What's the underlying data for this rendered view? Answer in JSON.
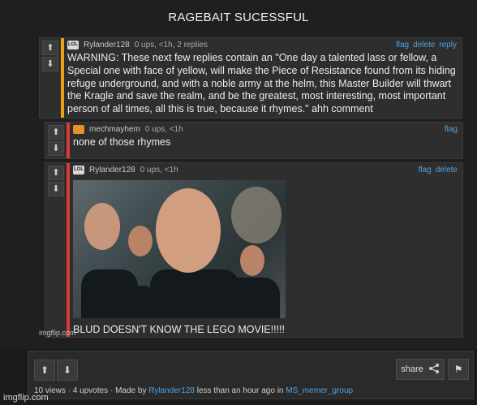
{
  "title": "RAGEBAIT SUCESSFUL",
  "comments": [
    {
      "username": "Rylander128",
      "meta": "0 ups, <1h, 2 replies",
      "actions": [
        "flag",
        "delete",
        "reply"
      ],
      "text": "WARNING: These next few replies contain an \"One day a talented lass or fellow, a Special one with face of yellow, will make the Piece of Resistance found from its hiding refuge underground, and with a noble army at the helm, this Master Builder will thwart the Kragle and save the realm, and be the greatest, most interesting, most important person of all times, all this is true, because it rhymes.\" ahh comment",
      "bar_color": "#e8a317"
    },
    {
      "username": "mechmayhem",
      "meta": "0 ups, <1h",
      "actions": [
        "flag"
      ],
      "text": "none of those rhymes",
      "bar_color": "#d63a3a"
    },
    {
      "username": "Rylander128",
      "meta": "0 ups, <1h",
      "actions": [
        "flag",
        "delete"
      ],
      "text": "BLUD DOESN'T KNOW THE LEGO MOVIE!!!!!",
      "bar_color": "#d63a3a"
    }
  ],
  "watermark": "imgflip.com",
  "footer": {
    "share_label": "share",
    "views": "10 views",
    "upvotes": "4 upvotes",
    "made_by_prefix": "Made by",
    "author": "Rylander128",
    "time_text": "less than an hour ago in",
    "stream": "MS_memer_group",
    "separator": "·"
  },
  "brand": "imgflip.com",
  "colors": {
    "link": "#4fa3e3",
    "accent_orange": "#e8a317",
    "accent_red": "#d63a3a"
  }
}
